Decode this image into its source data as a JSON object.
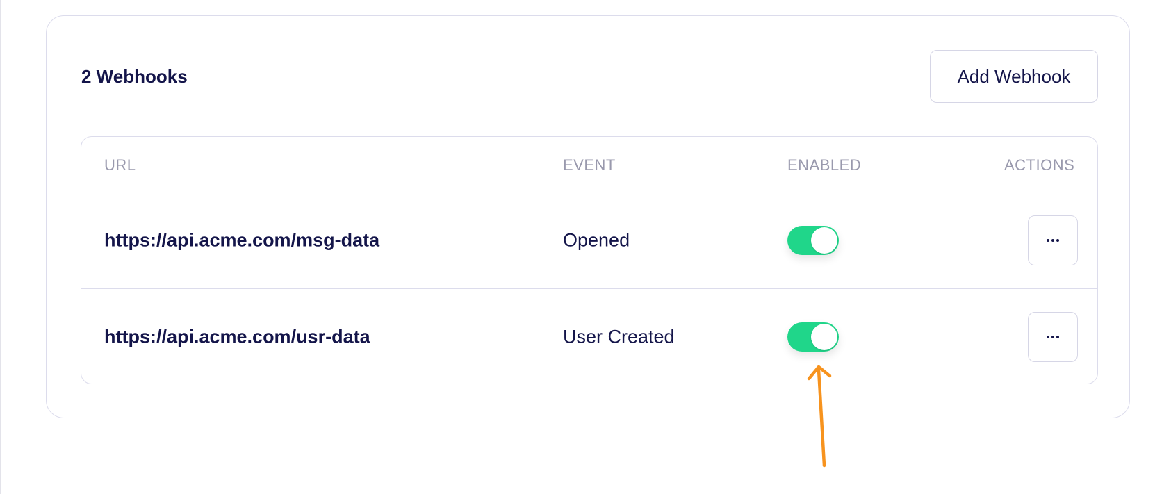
{
  "panel": {
    "title": "2 Webhooks",
    "add_button_label": "Add Webhook"
  },
  "table": {
    "headers": {
      "url": "URL",
      "event": "EVENT",
      "enabled": "ENABLED",
      "actions": "ACTIONS"
    },
    "rows": [
      {
        "url": "https://api.acme.com/msg-data",
        "event": "Opened",
        "enabled": true
      },
      {
        "url": "https://api.acme.com/usr-data",
        "event": "User Created",
        "enabled": true
      }
    ]
  },
  "colors": {
    "toggle_on": "#20d68a",
    "text_primary": "#14154a",
    "header_text": "#9999ad",
    "annotation_arrow": "#f7931e"
  },
  "icons": {
    "actions": "more-horizontal-icon",
    "annotation": "arrow-up-icon"
  }
}
